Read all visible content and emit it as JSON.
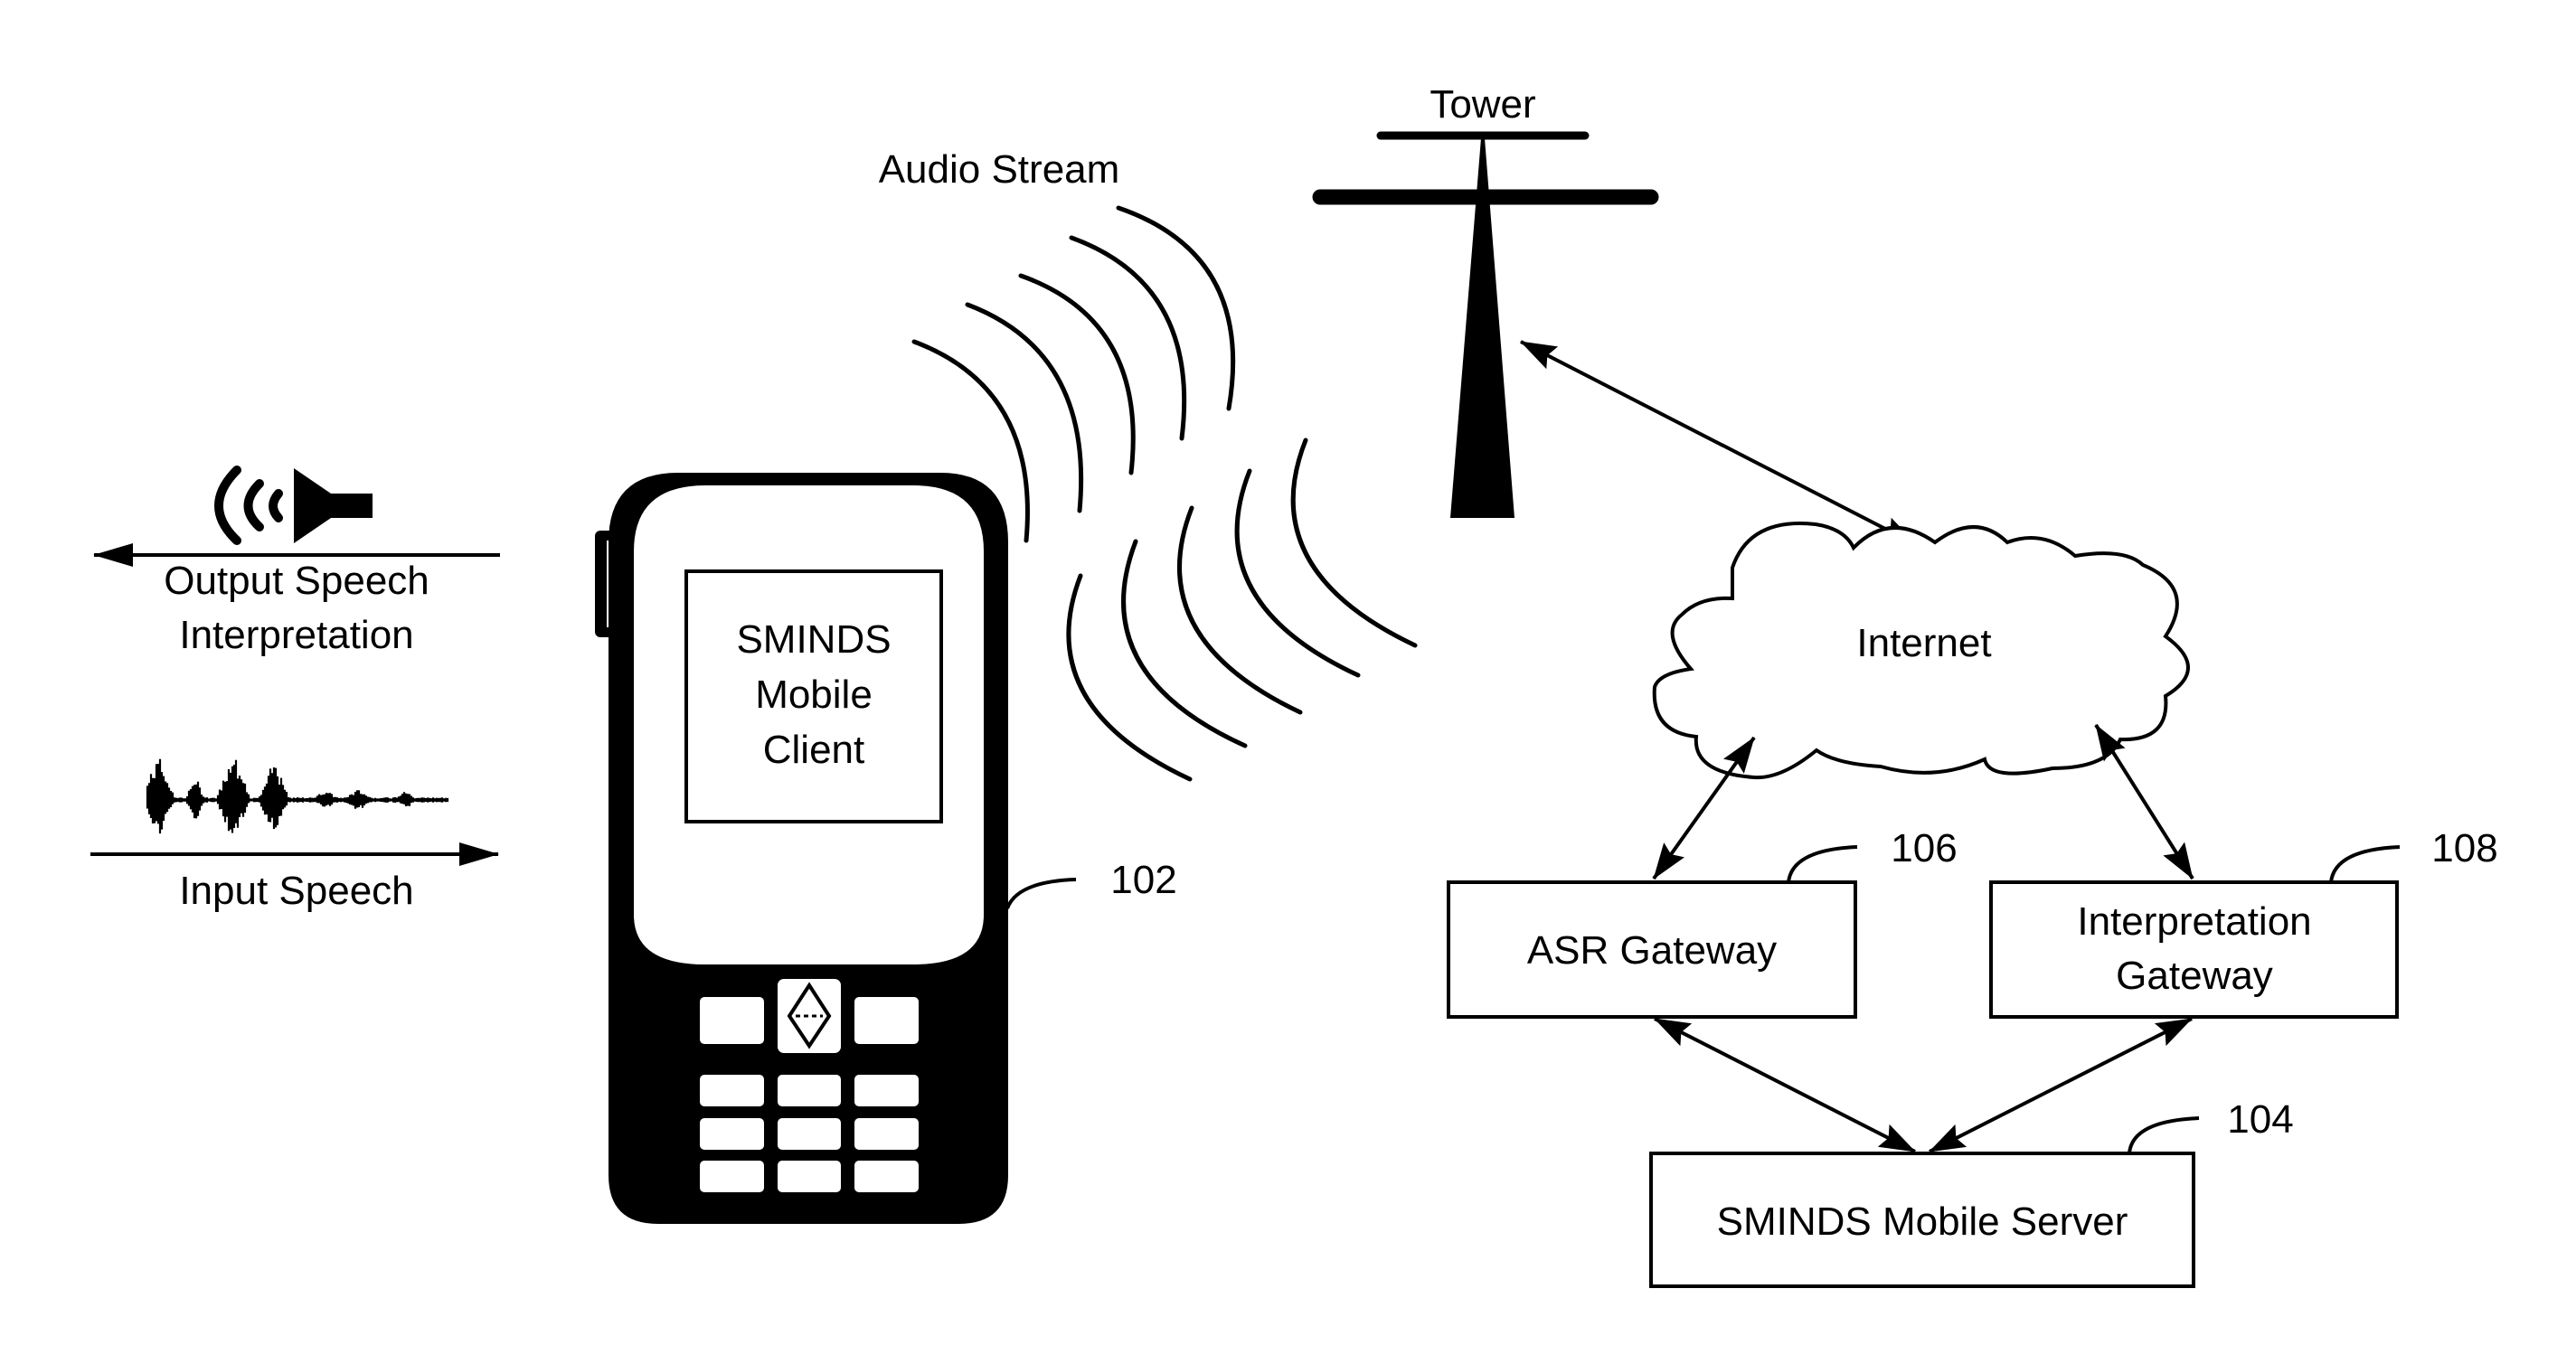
{
  "diagram": {
    "colors": {
      "ink": "#000000",
      "background": "#ffffff"
    },
    "labels": {
      "tower": "Tower",
      "audio_stream": "Audio Stream",
      "output_speech_line1": "Output Speech",
      "output_speech_line2": "Interpretation",
      "input_speech": "Input Speech",
      "internet": "Internet"
    },
    "mobile_client": {
      "line1": "SMINDS",
      "line2": "Mobile",
      "line3": "Client",
      "ref": "102"
    },
    "asr_gateway": {
      "label": "ASR Gateway",
      "ref": "106"
    },
    "interpretation_gateway": {
      "line1": "Interpretation",
      "line2": "Gateway",
      "ref": "108"
    },
    "mobile_server": {
      "label": "SMINDS Mobile Server",
      "ref": "104"
    },
    "icons": [
      "speaker-icon",
      "waveform-icon",
      "mobile-phone-icon",
      "tower-icon",
      "cloud-icon"
    ],
    "connections": [
      {
        "from": "tower",
        "to": "internet",
        "type": "bidirectional"
      },
      {
        "from": "internet",
        "to": "asr_gateway",
        "type": "bidirectional"
      },
      {
        "from": "internet",
        "to": "interpretation_gateway",
        "type": "bidirectional"
      },
      {
        "from": "asr_gateway",
        "to": "mobile_server",
        "type": "bidirectional"
      },
      {
        "from": "interpretation_gateway",
        "to": "mobile_server",
        "type": "bidirectional"
      },
      {
        "from": "mobile_client",
        "to": "output",
        "type": "output-speech"
      },
      {
        "from": "input",
        "to": "mobile_client",
        "type": "input-speech"
      }
    ]
  }
}
